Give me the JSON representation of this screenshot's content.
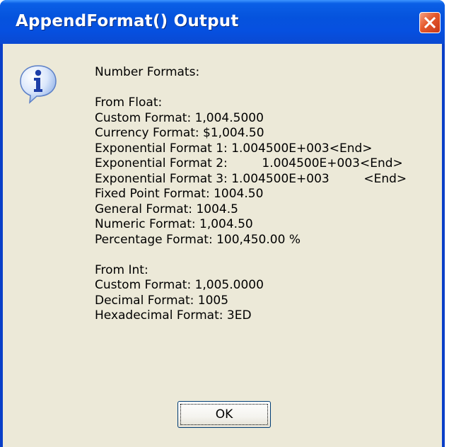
{
  "window": {
    "title": "AppendFormat() Output"
  },
  "icons": {
    "message_icon": "info-icon",
    "close_icon": "close-icon"
  },
  "message": {
    "lines": [
      "Number Formats:",
      "",
      "From Float:",
      "Custom Format: 1,004.5000",
      "Currency Format: $1,004.50",
      "Exponential Format 1: 1.004500E+003<End>",
      "Exponential Format 2:         1.004500E+003<End>",
      "Exponential Format 3: 1.004500E+003         <End>",
      "Fixed Point Format: 1004.50",
      "General Format: 1004.5",
      "Numeric Format: 1,004.50",
      "Percentage Format: 100,450.00 %",
      "",
      "From Int:",
      "Custom Format: 1,005.0000",
      "Decimal Format: 1005",
      "Hexadecimal Format: 3ED"
    ]
  },
  "buttons": {
    "ok_label": "OK"
  },
  "colors": {
    "titlebar": "#0553dd",
    "client_background": "#ece9d8",
    "close_button": "#e5582b"
  }
}
